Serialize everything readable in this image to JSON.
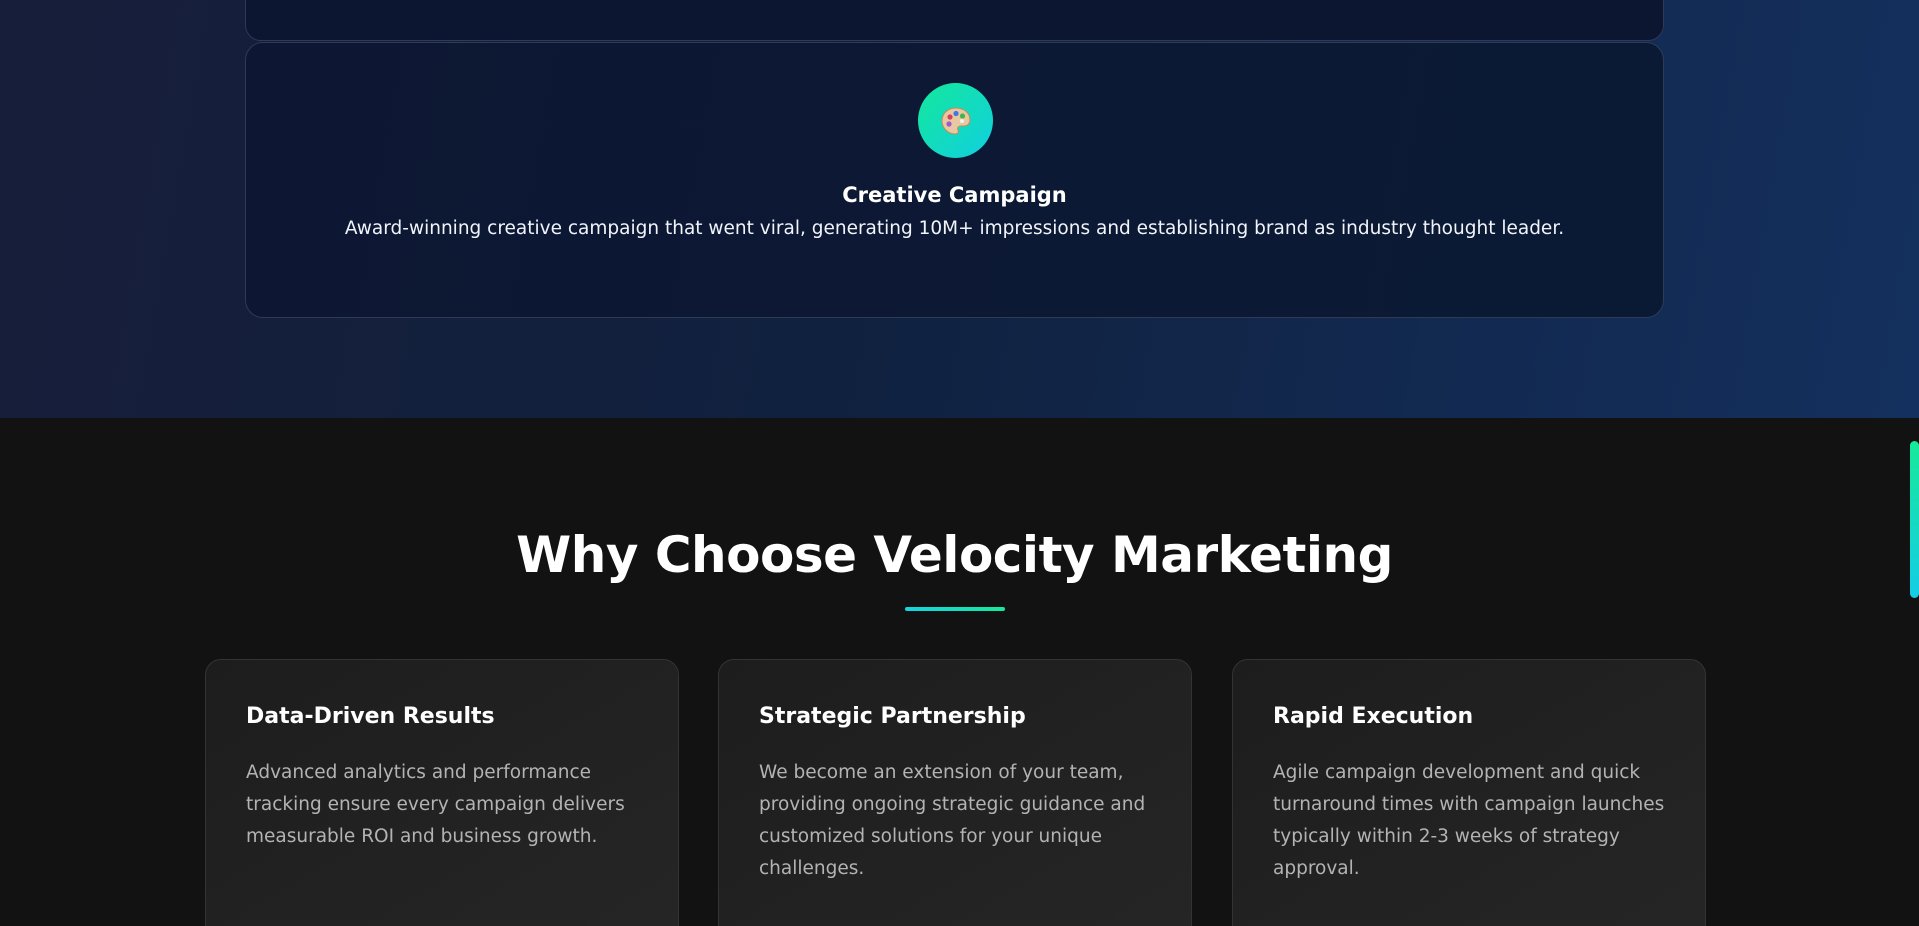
{
  "portfolio": {
    "project": {
      "icon": "artist-palette-icon",
      "icon_glyph": "🎨",
      "title": "Creative Campaign",
      "description": "Award-winning creative campaign that went viral, generating 10M+ impressions and establishing brand as industry thought leader."
    }
  },
  "why": {
    "title": "Why Choose Velocity Marketing",
    "features": [
      {
        "title": "Data-Driven Results",
        "description": "Advanced analytics and performance tracking ensure every campaign delivers measurable ROI and business growth."
      },
      {
        "title": "Strategic Partnership",
        "description": "We become an extension of your team, providing ongoing strategic guidance and customized solutions for your unique challenges."
      },
      {
        "title": "Rapid Execution",
        "description": "Agile campaign development and quick turnaround times with campaign launches typically within 2-3 weeks of strategy approval."
      }
    ]
  },
  "colors": {
    "accent_green": "#16e99a",
    "accent_cyan": "#14cde6",
    "navy": "#10213f",
    "dark_bg": "#121212"
  }
}
